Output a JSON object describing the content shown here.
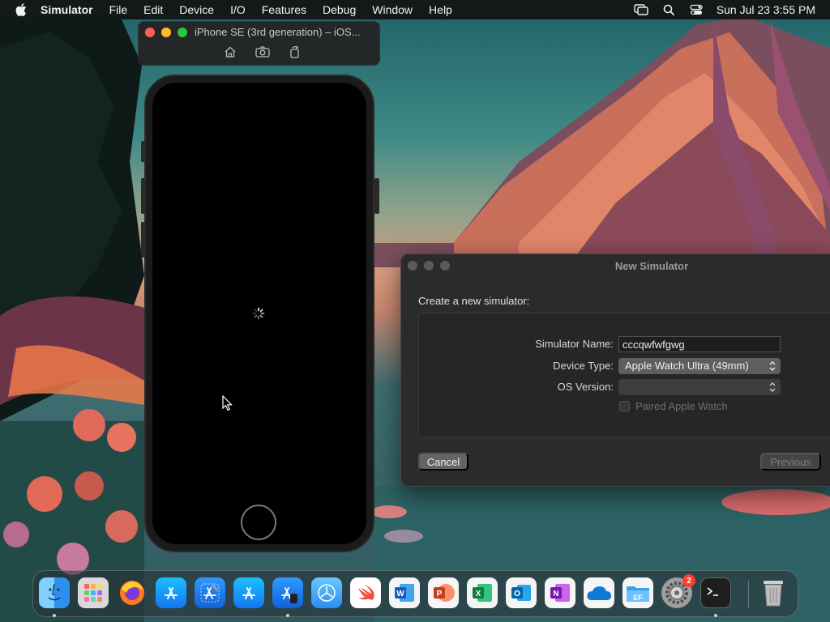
{
  "menubar": {
    "app_name": "Simulator",
    "items": [
      "File",
      "Edit",
      "Device",
      "I/O",
      "Features",
      "Debug",
      "Window",
      "Help"
    ],
    "clock": "Sun Jul 23  3:55 PM"
  },
  "simulator_window": {
    "title": "iPhone SE (3rd generation) – iOS...",
    "tools": [
      "home-icon",
      "screenshot-icon",
      "rotate-icon"
    ]
  },
  "dialog": {
    "title": "New Simulator",
    "heading": "Create a new simulator:",
    "name_label": "Simulator Name:",
    "name_value": "cccqwfwfgwg",
    "device_label": "Device Type:",
    "device_value": "Apple Watch Ultra (49mm)",
    "os_label": "OS Version:",
    "os_value": "",
    "paired_label": "Paired Apple Watch",
    "cancel_label": "Cancel",
    "previous_label": "Previous"
  },
  "dock": {
    "apps": [
      "finder",
      "launchpad",
      "firefox",
      "app-store",
      "xcode",
      "app-store-2",
      "xcode-instruments",
      "testflight",
      "swift-playgrounds",
      "microsoft-word",
      "microsoft-powerpoint",
      "microsoft-excel",
      "microsoft-outlook",
      "microsoft-onenote",
      "onedrive",
      "file-explorer",
      "system-settings",
      "terminal"
    ],
    "settings_badge": "2"
  },
  "colors": {
    "traffic_red": "#fe5f57",
    "traffic_yellow": "#febc2e",
    "traffic_green": "#28c840",
    "badge": "#ff3b30"
  }
}
